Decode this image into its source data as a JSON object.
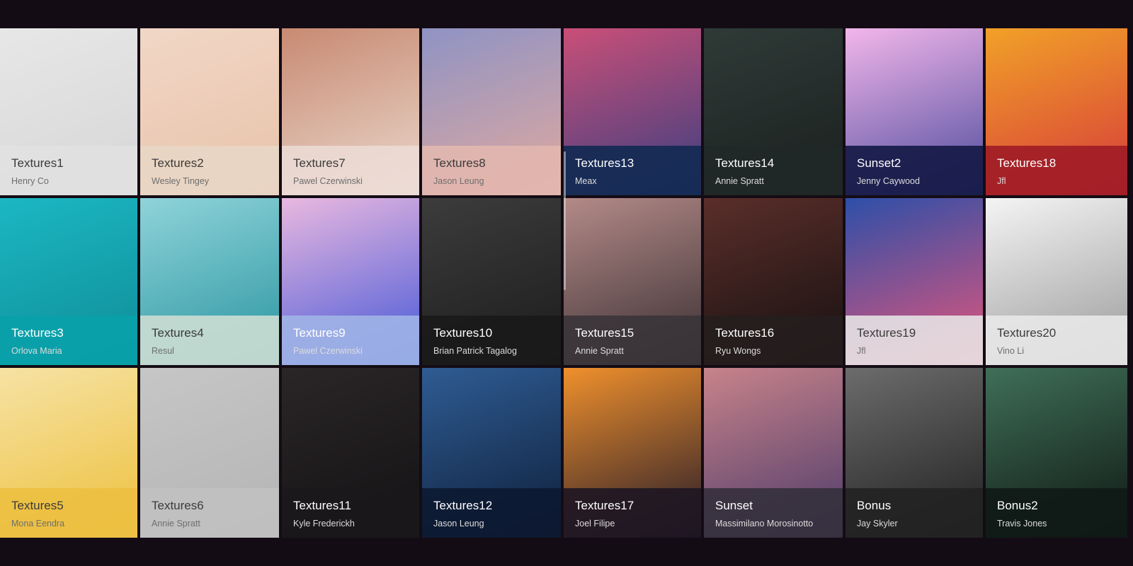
{
  "tiles": [
    {
      "title": "Textures1",
      "author": "Henry Co",
      "tone": "light",
      "bg": "#e7e7e7",
      "bg2": "#d6d6d6",
      "cap": "rgba(225,225,225,0.92)"
    },
    {
      "title": "Textures2",
      "author": "Wesley Tingey",
      "tone": "light",
      "bg": "#f1d7c6",
      "bg2": "#e8c2aa",
      "cap": "rgba(232,214,196,0.92)"
    },
    {
      "title": "Textures7",
      "author": "Pawel Czerwinski",
      "tone": "light",
      "bg": "#c88a72",
      "bg2": "#ead8cd",
      "cap": "rgba(236,220,214,0.85)"
    },
    {
      "title": "Textures8",
      "author": "Jason Leung",
      "tone": "light",
      "bg": "#8f93c4",
      "bg2": "#e0a99f",
      "cap": "rgba(226,183,175,0.9)"
    },
    {
      "title": "Textures13",
      "author": "Meax",
      "tone": "dark",
      "bg": "#c94f78",
      "bg2": "#3a3f80",
      "cap": "rgba(18,42,82,0.92)"
    },
    {
      "title": "Textures14",
      "author": "Annie Spratt",
      "tone": "dark",
      "bg": "#2f3a37",
      "bg2": "#1a201f",
      "cap": "rgba(32,40,40,0.9)"
    },
    {
      "title": "Sunset2",
      "author": "Jenny Caywood",
      "tone": "dark",
      "bg": "#f2b6ea",
      "bg2": "#4c4a9c",
      "cap": "rgba(22,26,70,0.92)"
    },
    {
      "title": "Textures18",
      "author": "Jfl",
      "tone": "dark",
      "bg": "#f1a128",
      "bg2": "#d63a3a",
      "cap": "rgba(158,28,38,0.9)"
    },
    {
      "title": "Textures3",
      "author": "Orlova Maria",
      "tone": "dark",
      "bg": "#1bb7c2",
      "bg2": "#0f8d98",
      "cap": "rgba(10,160,170,0.95)"
    },
    {
      "title": "Textures4",
      "author": "Resul",
      "tone": "light",
      "bg": "#8fd3d9",
      "bg2": "#2a95a1",
      "cap": "rgba(200,220,210,0.93)"
    },
    {
      "title": "Textures9",
      "author": "Pawel Czerwinski",
      "tone": "dark",
      "bg": "#e9b8df",
      "bg2": "#4457d8",
      "cap": "rgba(160,180,230,0.9)"
    },
    {
      "title": "Textures10",
      "author": "Brian Patrick Tagalog",
      "tone": "dark",
      "bg": "#3c3c3c",
      "bg2": "#1c1c1c",
      "cap": "rgba(26,26,26,0.9)"
    },
    {
      "title": "Textures15",
      "author": "Annie Spratt",
      "tone": "dark",
      "bg": "#b38a88",
      "bg2": "#3a2f32",
      "cap": "rgba(58,52,56,0.9)"
    },
    {
      "title": "Textures16",
      "author": "Ryu Wongs",
      "tone": "dark",
      "bg": "#5a2e2a",
      "bg2": "#151010",
      "cap": "rgba(38,30,30,0.9)"
    },
    {
      "title": "Textures19",
      "author": "Jfl",
      "tone": "light",
      "bg": "#2d4fa8",
      "bg2": "#e6567a",
      "cap": "rgba(230,230,230,0.88)"
    },
    {
      "title": "Textures20",
      "author": "Vino Li",
      "tone": "light",
      "bg": "#f4f4f4",
      "bg2": "#9a9a9a",
      "cap": "rgba(232,232,232,0.9)"
    },
    {
      "title": "Textures5",
      "author": "Mona Eendra",
      "tone": "light",
      "bg": "#f6e2a4",
      "bg2": "#edc03c",
      "cap": "rgba(236,192,66,0.95)"
    },
    {
      "title": "Textures6",
      "author": "Annie Spratt",
      "tone": "light",
      "bg": "#c6c6c6",
      "bg2": "#b4b4b4",
      "cap": "rgba(192,192,192,0.95)"
    },
    {
      "title": "Textures11",
      "author": "Kyle Frederickh",
      "tone": "dark",
      "bg": "#2a2628",
      "bg2": "#141214",
      "cap": "rgba(26,24,26,0.88)"
    },
    {
      "title": "Textures12",
      "author": "Jason Leung",
      "tone": "dark",
      "bg": "#2f5c93",
      "bg2": "#0e1f3a",
      "cap": "rgba(12,24,48,0.88)"
    },
    {
      "title": "Textures17",
      "author": "Joel Filipe",
      "tone": "dark",
      "bg": "#f0902c",
      "bg2": "#221a2a",
      "cap": "rgba(30,22,34,0.9)"
    },
    {
      "title": "Sunset",
      "author": "Massimilano Morosinotto",
      "tone": "dark",
      "bg": "#c7838a",
      "bg2": "#4d3a6a",
      "cap": "rgba(52,48,60,0.9)"
    },
    {
      "title": "Bonus",
      "author": "Jay Skyler",
      "tone": "dark",
      "bg": "#6c6c6c",
      "bg2": "#1f1f1f",
      "cap": "rgba(34,34,34,0.9)"
    },
    {
      "title": "Bonus2",
      "author": "Travis Jones",
      "tone": "dark",
      "bg": "#3f6f58",
      "bg2": "#0f1713",
      "cap": "rgba(16,26,22,0.9)"
    }
  ]
}
